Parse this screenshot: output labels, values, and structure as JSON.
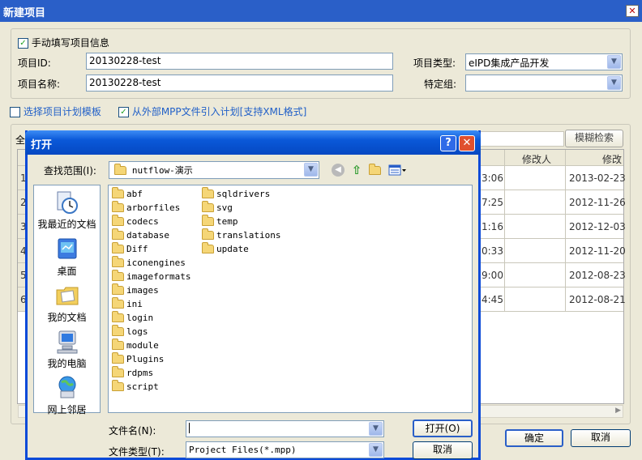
{
  "main": {
    "title": "新建项目",
    "close_glyph": "✕",
    "manual_checkbox_label": "手动填写项目信息",
    "manual_checked": "✓",
    "project_id_label": "项目ID:",
    "project_id_value": "20130228-test",
    "project_name_label": "项目名称:",
    "project_name_value": "20130228-test",
    "project_type_label": "项目类型:",
    "project_type_value": "eIPD集成产品开发",
    "specific_group_label": "特定组:",
    "specific_group_value": "",
    "template_checkbox_label": "选择项目计划模板",
    "import_checkbox_label": "从外部MPP文件引入计划[支持XML格式]",
    "import_checked": "✓",
    "fuzzy_search_label": "模糊检索",
    "ok_label": "确定",
    "cancel_label": "取消",
    "partial_left_label": "全",
    "table": {
      "headers": [
        "修改人",
        "修改"
      ],
      "row_numbers": [
        "1",
        "2",
        "3",
        "4",
        "5",
        "6"
      ],
      "times": [
        "3:06",
        "7:25",
        "1:16",
        "0:33",
        "9:00",
        "4:45"
      ],
      "dates": [
        "2013-02-23",
        "2012-11-26",
        "2012-12-03",
        "2012-11-20",
        "2012-08-23",
        "2012-08-21"
      ]
    }
  },
  "open_dialog": {
    "title": "打开",
    "help_glyph": "?",
    "close_glyph": "✕",
    "look_in_label": "查找范围(I):",
    "look_in_value": "nutflow-演示",
    "places": [
      {
        "label": "我最近的文档",
        "icon": "recent-documents-icon"
      },
      {
        "label": "桌面",
        "icon": "desktop-icon"
      },
      {
        "label": "我的文档",
        "icon": "my-documents-icon"
      },
      {
        "label": "我的电脑",
        "icon": "my-computer-icon"
      },
      {
        "label": "网上邻居",
        "icon": "network-places-icon"
      }
    ],
    "folders_col1": [
      "abf",
      "arborfiles",
      "codecs",
      "database",
      "Diff",
      "iconengines",
      "imageformats",
      "images",
      "ini",
      "login",
      "logs",
      "module",
      "Plugins",
      "rdpms",
      "script"
    ],
    "folders_col2": [
      "sqldrivers",
      "svg",
      "temp",
      "translations",
      "update"
    ],
    "filename_label": "文件名(N):",
    "filename_value": "",
    "filetype_label": "文件类型(T):",
    "filetype_value": "Project Files(*.mpp)",
    "open_button_label": "打开(O)",
    "cancel_button_label": "取消"
  },
  "colors": {
    "xp_title_blue": "#0a58d8",
    "link_blue": "#2160c8",
    "dialog_face": "#ece9d8"
  }
}
